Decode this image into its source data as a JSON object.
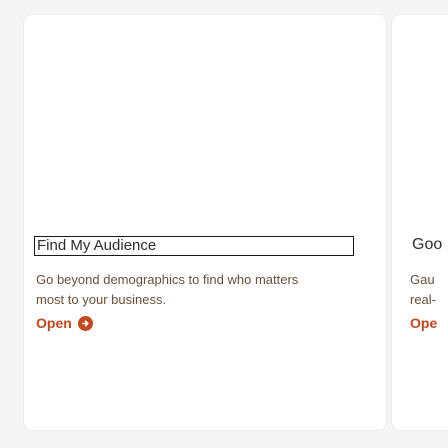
{
  "colors": {
    "page_bg": "#f5f5f5",
    "card_bg": "#ffffff",
    "title_text": "#2e2e2e",
    "description_text": "#6b4f3a",
    "accent": "#c4471d"
  },
  "cards": [
    {
      "title": "Find My Audience",
      "description": "Go beyond demographics to find who matters most to your business.",
      "open_label": "Open",
      "open_icon": "arrow-right-circle-icon"
    },
    {
      "title": "Goo",
      "description_line1": "Gau",
      "description_line2": "real-",
      "open_label": "Ope"
    }
  ]
}
